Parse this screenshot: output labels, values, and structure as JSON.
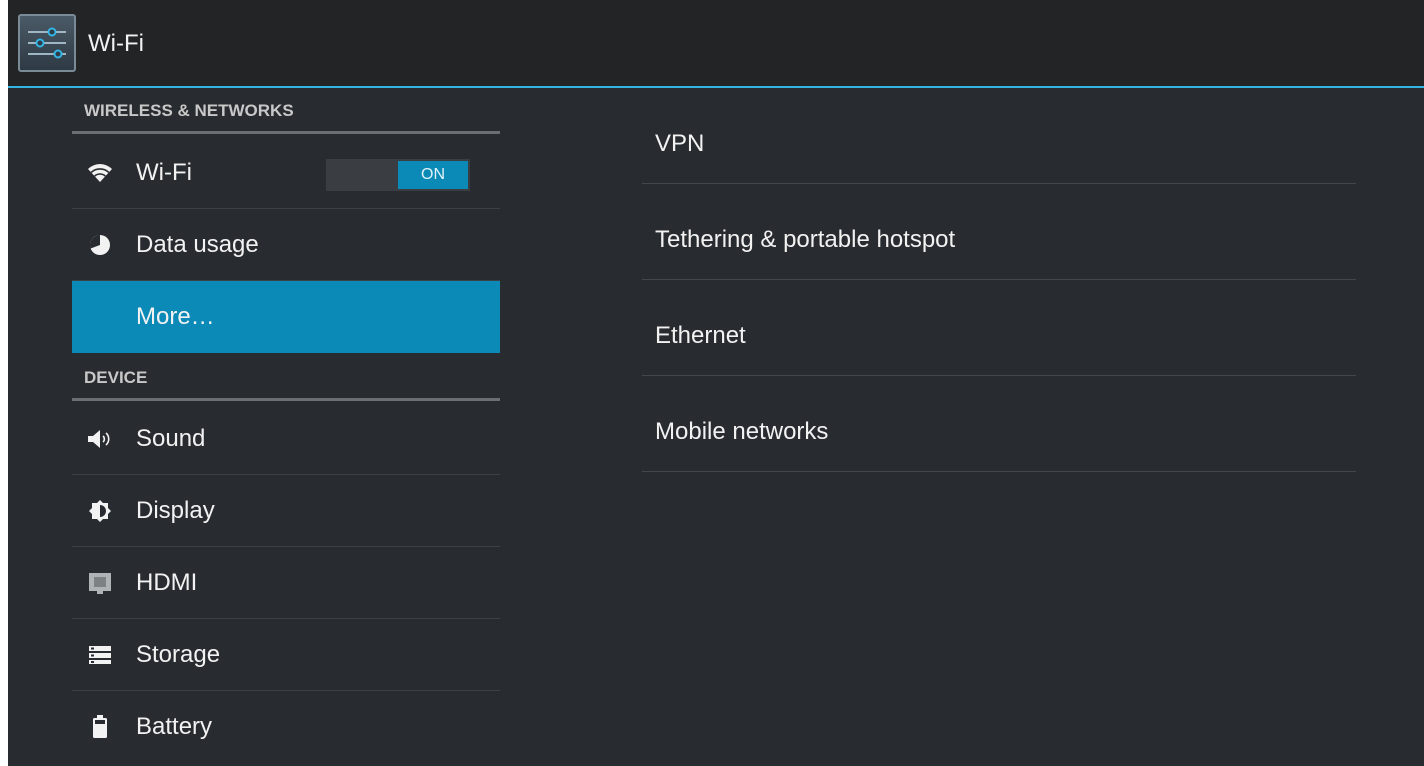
{
  "action_bar": {
    "title": "Wi-Fi",
    "icon": "settings-sliders-icon"
  },
  "colors": {
    "accent": "#33b5e5",
    "selected": "#0b8ab7",
    "background": "#282b2f"
  },
  "left_pane": {
    "sections": [
      {
        "header": "WIRELESS & NETWORKS",
        "items": [
          {
            "label": "Wi-Fi",
            "icon": "wifi-icon",
            "toggle": "ON"
          },
          {
            "label": "Data usage",
            "icon": "data-usage-icon"
          },
          {
            "label": "More…",
            "selected": true
          }
        ]
      },
      {
        "header": "DEVICE",
        "items": [
          {
            "label": "Sound",
            "icon": "sound-icon"
          },
          {
            "label": "Display",
            "icon": "display-icon"
          },
          {
            "label": "HDMI",
            "icon": "hdmi-icon"
          },
          {
            "label": "Storage",
            "icon": "storage-icon"
          },
          {
            "label": "Battery",
            "icon": "battery-icon"
          }
        ]
      }
    ]
  },
  "right_pane": {
    "items": [
      {
        "label": "VPN"
      },
      {
        "label": "Tethering & portable hotspot"
      },
      {
        "label": "Ethernet"
      },
      {
        "label": "Mobile networks"
      }
    ]
  }
}
